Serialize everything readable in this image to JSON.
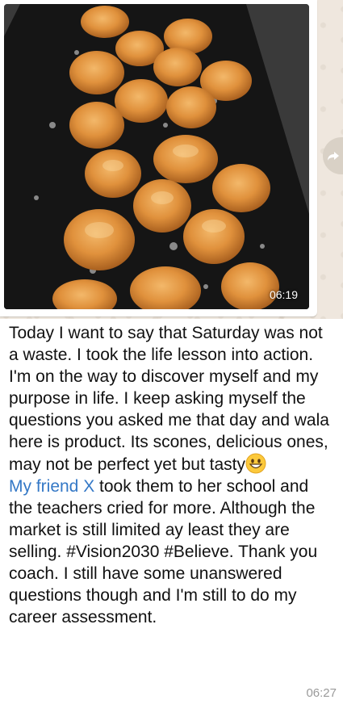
{
  "image_message": {
    "time": "06:19"
  },
  "text_message": {
    "part1": "Today I want to say that Saturday was not a waste. I took the life lesson into action. I'm on the way to discover myself and my purpose in life. I keep asking myself the questions you asked me that day and wala here is product. Its scones, delicious ones, may not be perfect yet but tasty",
    "emoji": "grinning-face",
    "mention": "My friend X",
    "part2": " took them to her school and the teachers cried for more. Although the market is still limited ay least they are selling. #Vision2030 #Believe. Thank you coach. I still have some unanswered questions though and I'm still to do my career assessment.",
    "time": "06:27"
  },
  "colors": {
    "chat_background": "#efe7de",
    "bubble": "#ffffff",
    "mention": "#3478c6",
    "timestamp": "#9a9a9a"
  }
}
